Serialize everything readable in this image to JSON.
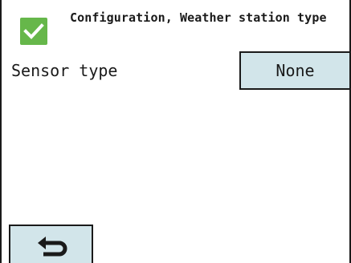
{
  "header": {
    "title": "Configuration, Weather station type",
    "status_icon": "check-icon",
    "status_color": "#66b74a"
  },
  "setting": {
    "label": "Sensor type",
    "value": "None",
    "button_color": "#d2e5ea"
  },
  "footer": {
    "back_icon": "return-arrow-icon"
  }
}
